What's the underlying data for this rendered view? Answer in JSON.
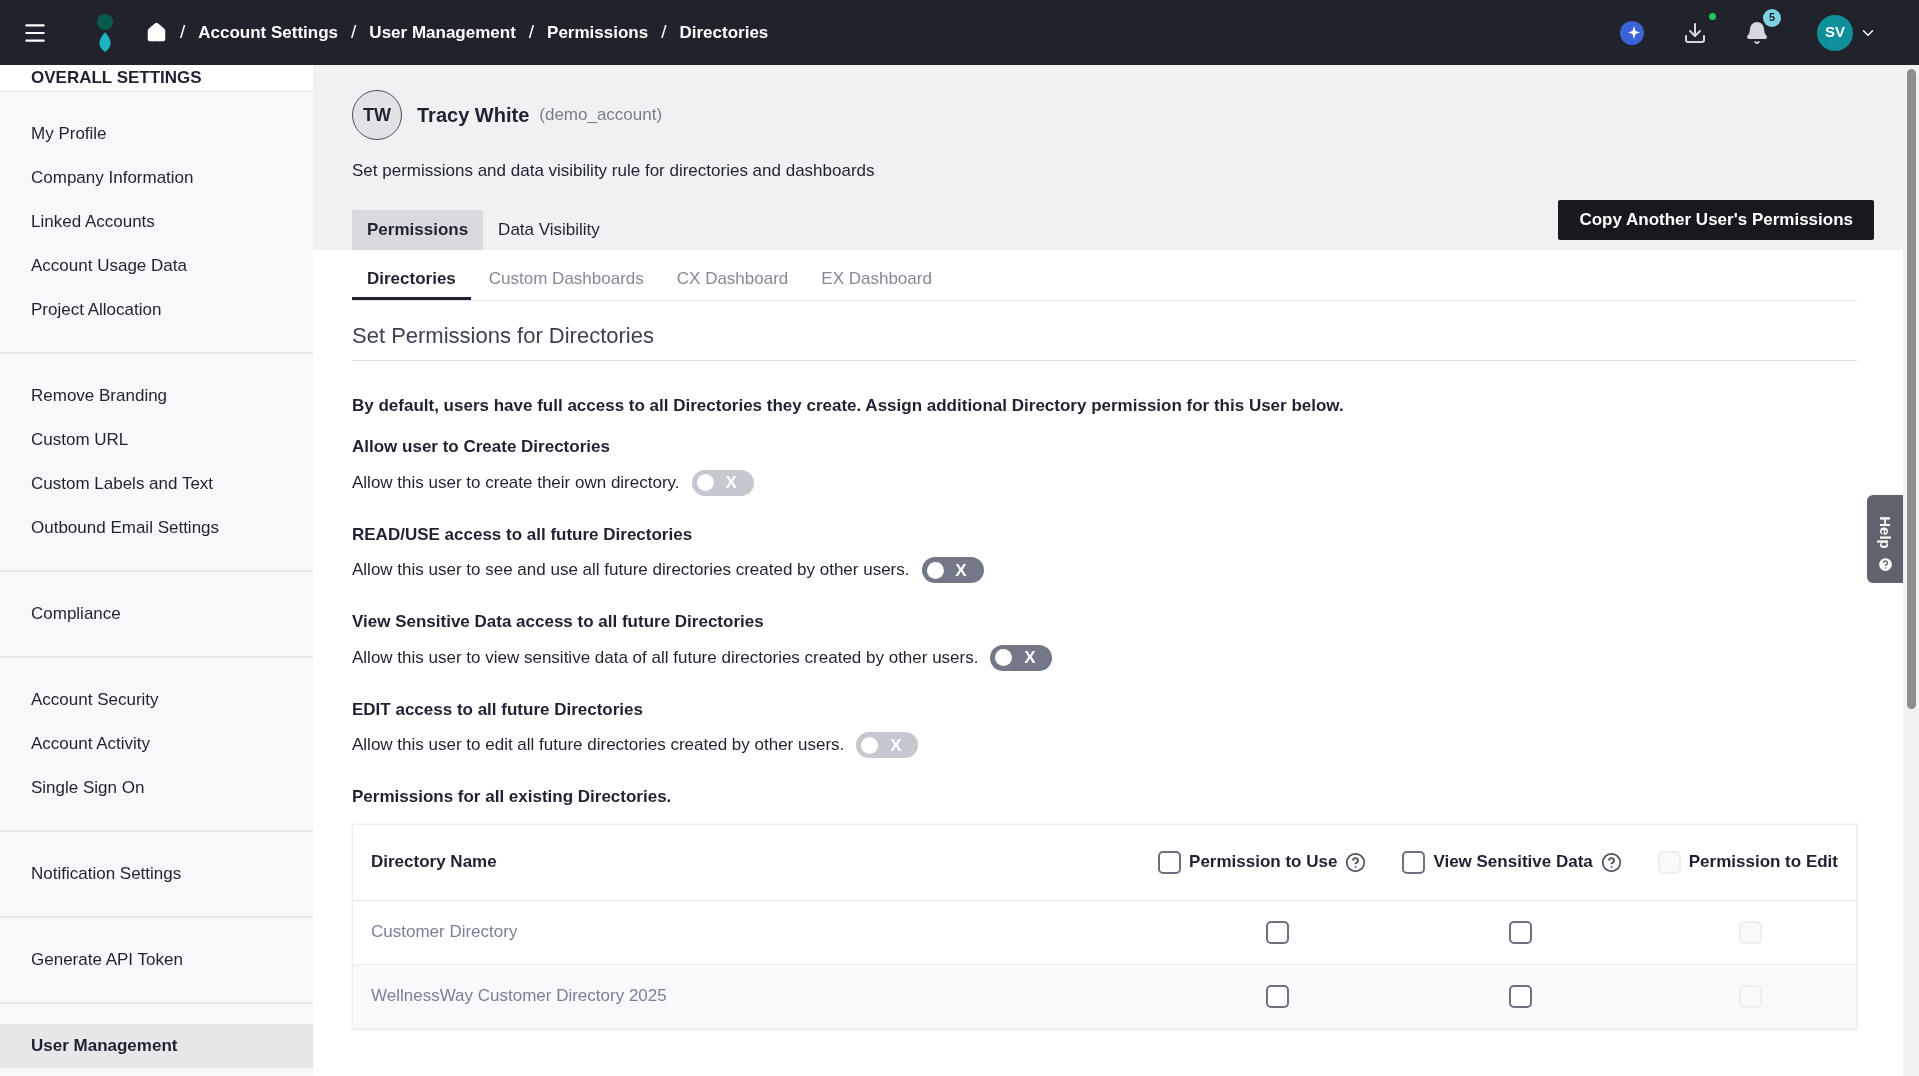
{
  "topbar": {
    "breadcrumbs": [
      "Account Settings",
      "User Management",
      "Permissions",
      "Directories"
    ],
    "separator": "/",
    "notifications_count": "5",
    "user_initials": "SV"
  },
  "sidebar": {
    "title": "OVERALL SETTINGS",
    "groups": [
      {
        "items": [
          {
            "label": "My Profile",
            "selected": false
          },
          {
            "label": "Company Information",
            "selected": false
          },
          {
            "label": "Linked Accounts",
            "selected": false
          },
          {
            "label": "Account Usage Data",
            "selected": false
          },
          {
            "label": "Project Allocation",
            "selected": false
          }
        ]
      },
      {
        "items": [
          {
            "label": "Remove Branding",
            "selected": false
          },
          {
            "label": "Custom URL",
            "selected": false
          },
          {
            "label": "Custom Labels and Text",
            "selected": false
          },
          {
            "label": "Outbound Email Settings",
            "selected": false
          }
        ]
      },
      {
        "items": [
          {
            "label": "Compliance",
            "selected": false
          }
        ]
      },
      {
        "items": [
          {
            "label": "Account Security",
            "selected": false
          },
          {
            "label": "Account Activity",
            "selected": false
          },
          {
            "label": "Single Sign On",
            "selected": false
          }
        ]
      },
      {
        "items": [
          {
            "label": "Notification Settings",
            "selected": false
          }
        ]
      },
      {
        "items": [
          {
            "label": "Generate API Token",
            "selected": false
          }
        ]
      },
      {
        "items": [
          {
            "label": "User Management",
            "selected": true
          }
        ]
      }
    ]
  },
  "user": {
    "initials": "TW",
    "name": "Tracy White",
    "account": "(demo_account)",
    "description": "Set permissions and data visibility rule for directories and dashboards"
  },
  "tabs": [
    {
      "label": "Permissions",
      "selected": true
    },
    {
      "label": "Data Visibility",
      "selected": false
    }
  ],
  "copy_button": "Copy Another User's Permissions",
  "subtabs": [
    {
      "label": "Directories",
      "selected": true
    },
    {
      "label": "Custom Dashboards",
      "selected": false
    },
    {
      "label": "CX Dashboard",
      "selected": false
    },
    {
      "label": "EX Dashboard",
      "selected": false
    }
  ],
  "section_title": "Set Permissions for Directories",
  "intro": "By default, users have full access to all Directories they create. Assign additional Directory permission for this User below.",
  "settings": [
    {
      "title": "Allow user to Create Directories",
      "description": "Allow this user to create their own directory.",
      "on": false,
      "disabled": true,
      "toggle_mark": "X"
    },
    {
      "title": "READ/USE access to all future Directories",
      "description": "Allow this user to see and use all future directories created by other users.",
      "on": false,
      "disabled": false,
      "toggle_mark": "X"
    },
    {
      "title": "View Sensitive Data access to all future Directories",
      "description": "Allow this user to view sensitive data of all future directories created by other users.",
      "on": false,
      "disabled": false,
      "toggle_mark": "X"
    },
    {
      "title": "EDIT access to all future Directories",
      "description": "Allow this user to edit all future directories created by other users.",
      "on": false,
      "disabled": true,
      "toggle_mark": "X"
    }
  ],
  "table": {
    "title": "Permissions for all existing Directories.",
    "name_column": "Directory Name",
    "columns": [
      {
        "label": "Permission to Use",
        "help": true,
        "checked": false,
        "disabled": false
      },
      {
        "label": "View Sensitive Data",
        "help": true,
        "checked": false,
        "disabled": false
      },
      {
        "label": "Permission to Edit",
        "help": false,
        "checked": false,
        "disabled": true
      }
    ],
    "rows": [
      {
        "name": "Customer Directory",
        "cells": [
          {
            "checked": false,
            "disabled": false
          },
          {
            "checked": false,
            "disabled": false
          },
          {
            "checked": false,
            "disabled": true
          }
        ]
      },
      {
        "name": "WellnessWay Customer Directory 2025",
        "cells": [
          {
            "checked": false,
            "disabled": false
          },
          {
            "checked": false,
            "disabled": false
          },
          {
            "checked": false,
            "disabled": true
          }
        ]
      }
    ]
  },
  "help_tab": "Help"
}
